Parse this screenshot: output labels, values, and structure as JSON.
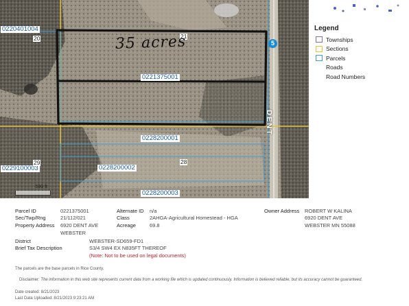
{
  "map": {
    "parcel_labels": {
      "p1": "0220401004",
      "p2": "0221375001",
      "p3": "0228200001",
      "p4": "0229100003",
      "p5": "0228200002",
      "p6": "0228200003"
    },
    "section_labels": {
      "s20": "20",
      "s21": "21",
      "s29": "29",
      "s28": "28"
    },
    "handwriting": "35 acres",
    "road_name": "DENT",
    "route_shield": "5",
    "scale_text": "590 ft"
  },
  "legend": {
    "title": "Legend",
    "items": [
      {
        "label": "Townships",
        "color": "#7a6fbf",
        "swatch": true
      },
      {
        "label": "Sections",
        "color": "#e6c23a",
        "swatch": true
      },
      {
        "label": "Parcels",
        "color": "#3a9fd8",
        "swatch": true
      },
      {
        "label": "Roads",
        "swatch": false
      },
      {
        "label": "Road Numbers",
        "swatch": false
      }
    ]
  },
  "info": {
    "parcel_id_label": "Parcel ID",
    "parcel_id": "0221375001",
    "sec_label": "Sec/Twp/Rng",
    "sec": "21/112/021",
    "property_address_label": "Property Address",
    "property_address_1": "6920 DENT AVE",
    "property_address_2": "WEBSTER",
    "alternate_id_label": "Alternate ID",
    "alternate_id": "n/a",
    "class_label": "Class",
    "class": "2AHGA-Agricultural Homestead - HGA",
    "acreage_label": "Acreage",
    "acreage": "69.8",
    "owner_label": "Owner Address",
    "owner_1": "ROBERT W KALINA",
    "owner_2": "6920 DENT AVE",
    "owner_3": "WEBSTER MN 55088",
    "district_label": "District",
    "district": "WEBSTER-SD659-FD1",
    "tax_label": "Brief Tax Description",
    "tax_1": "S3/4 SW4 EX N835FT THEREOF",
    "tax_note": "(Note: Not to be used on legal documents)",
    "base_note": "The parcels are the base parcels in Rice County.",
    "disclaimer_label": "Disclaimer:",
    "disclaimer": "The information in this web site represents current data from a working file which is updated continuously. Information is believed reliable, but its accuracy cannot be guaranteed.",
    "date_created": "Date created: 8/21/2023",
    "date_uploaded": "Last Data Uploaded: 8/21/2023 9:23:21 AM"
  },
  "colors": {
    "parcel_line": "#3a9fd8",
    "section_line": "#e6c23a",
    "parcel_label_text": "#1a5aa0",
    "note_red": "#c0202a"
  }
}
